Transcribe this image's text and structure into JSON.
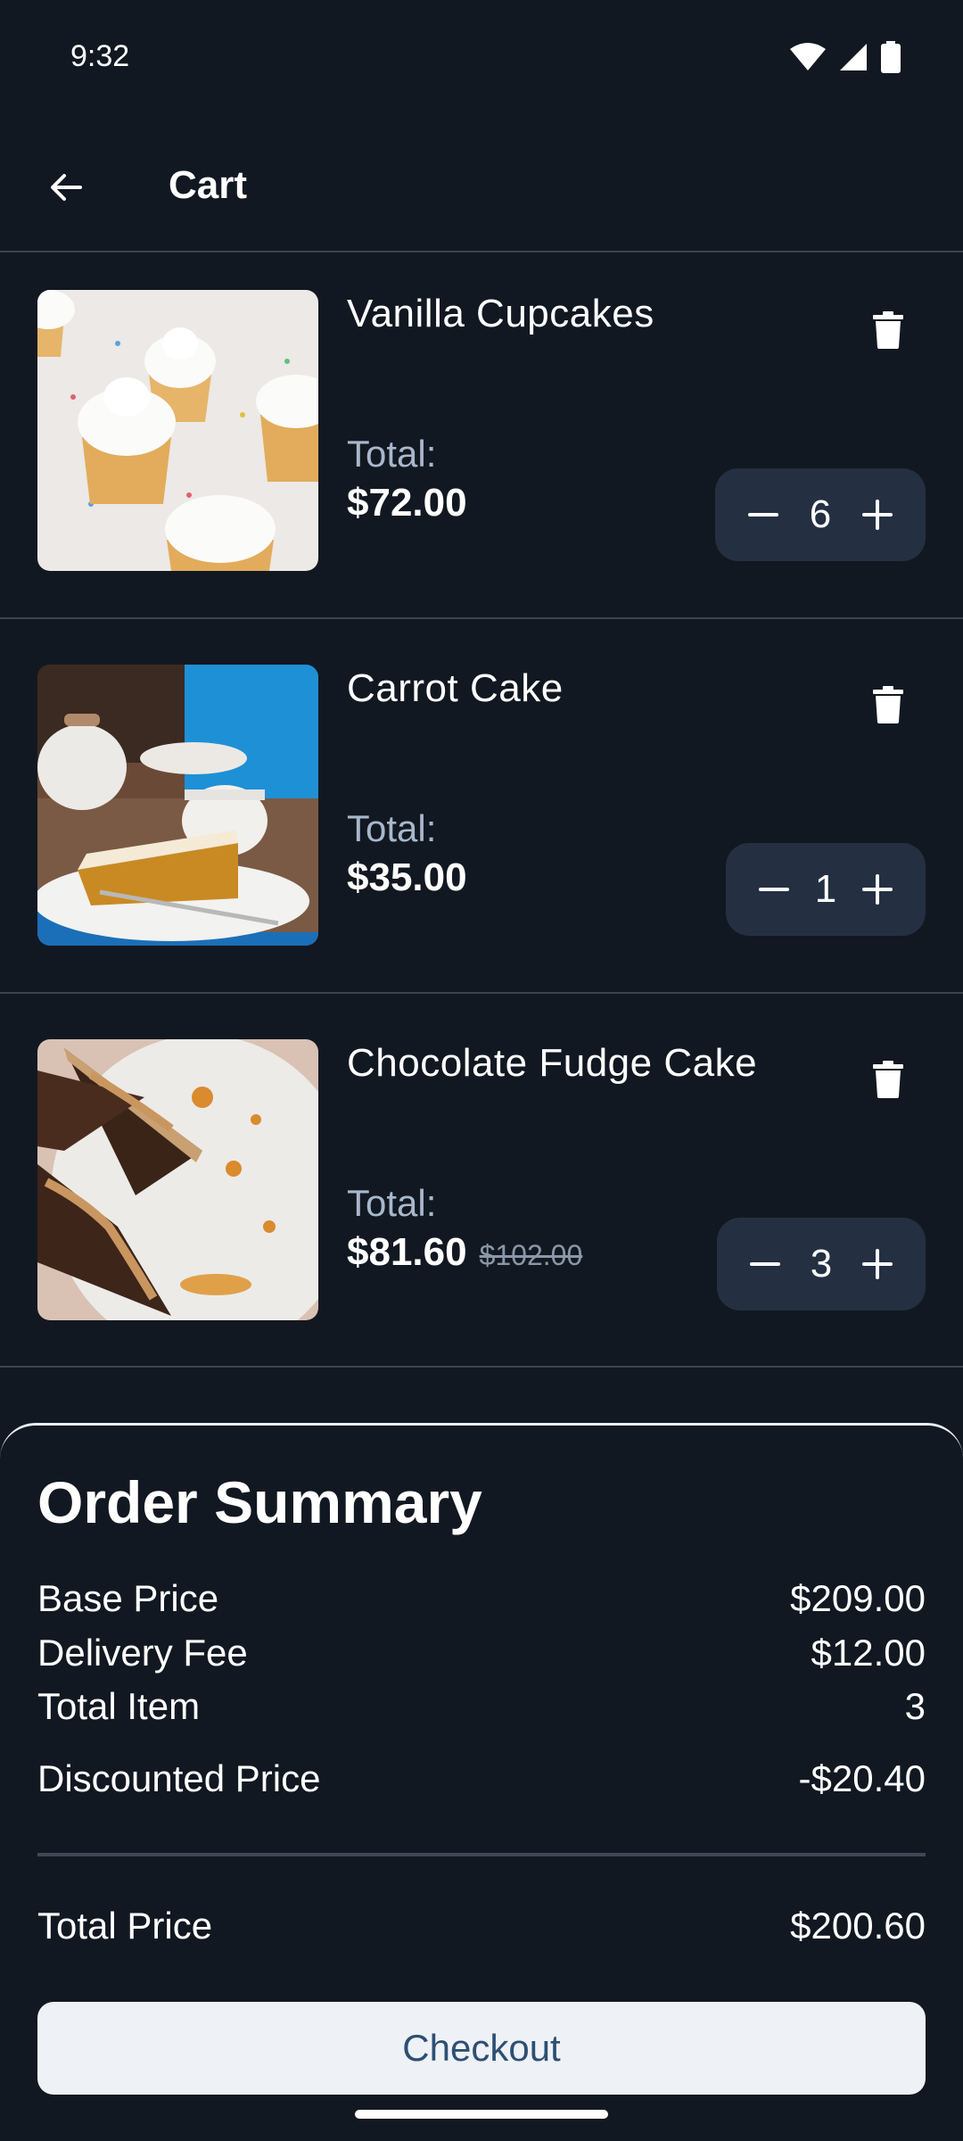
{
  "status_bar": {
    "time": "9:32"
  },
  "app_bar": {
    "title": "Cart"
  },
  "cart": {
    "items": [
      {
        "name": "Vanilla Cupcakes",
        "total_label": "Total:",
        "price": "$72.00",
        "old_price": "",
        "quantity": "6",
        "image": "vanilla-cupcakes-photo"
      },
      {
        "name": "Carrot Cake",
        "total_label": "Total:",
        "price": "$35.00",
        "old_price": "",
        "quantity": "1",
        "image": "carrot-cake-photo"
      },
      {
        "name": "Chocolate Fudge Cake",
        "total_label": "Total:",
        "price": "$81.60",
        "old_price": "$102.00",
        "quantity": "3",
        "image": "chocolate-fudge-cake-photo"
      }
    ]
  },
  "summary": {
    "title": "Order Summary",
    "base_price_label": "Base Price",
    "base_price_value": "$209.00",
    "delivery_fee_label": "Delivery Fee",
    "delivery_fee_value": "$12.00",
    "total_item_label": "Total Item",
    "total_item_value": "3",
    "discounted_label": "Discounted Price",
    "discounted_value": "-$20.40",
    "total_price_label": "Total Price",
    "total_price_value": "$200.60",
    "checkout_label": "Checkout"
  },
  "colors": {
    "background": "#121821",
    "stepper": "#243042",
    "muted_text": "#a8b8cc",
    "checkout_bg": "#eef1f6",
    "checkout_text": "#2d4f73"
  }
}
